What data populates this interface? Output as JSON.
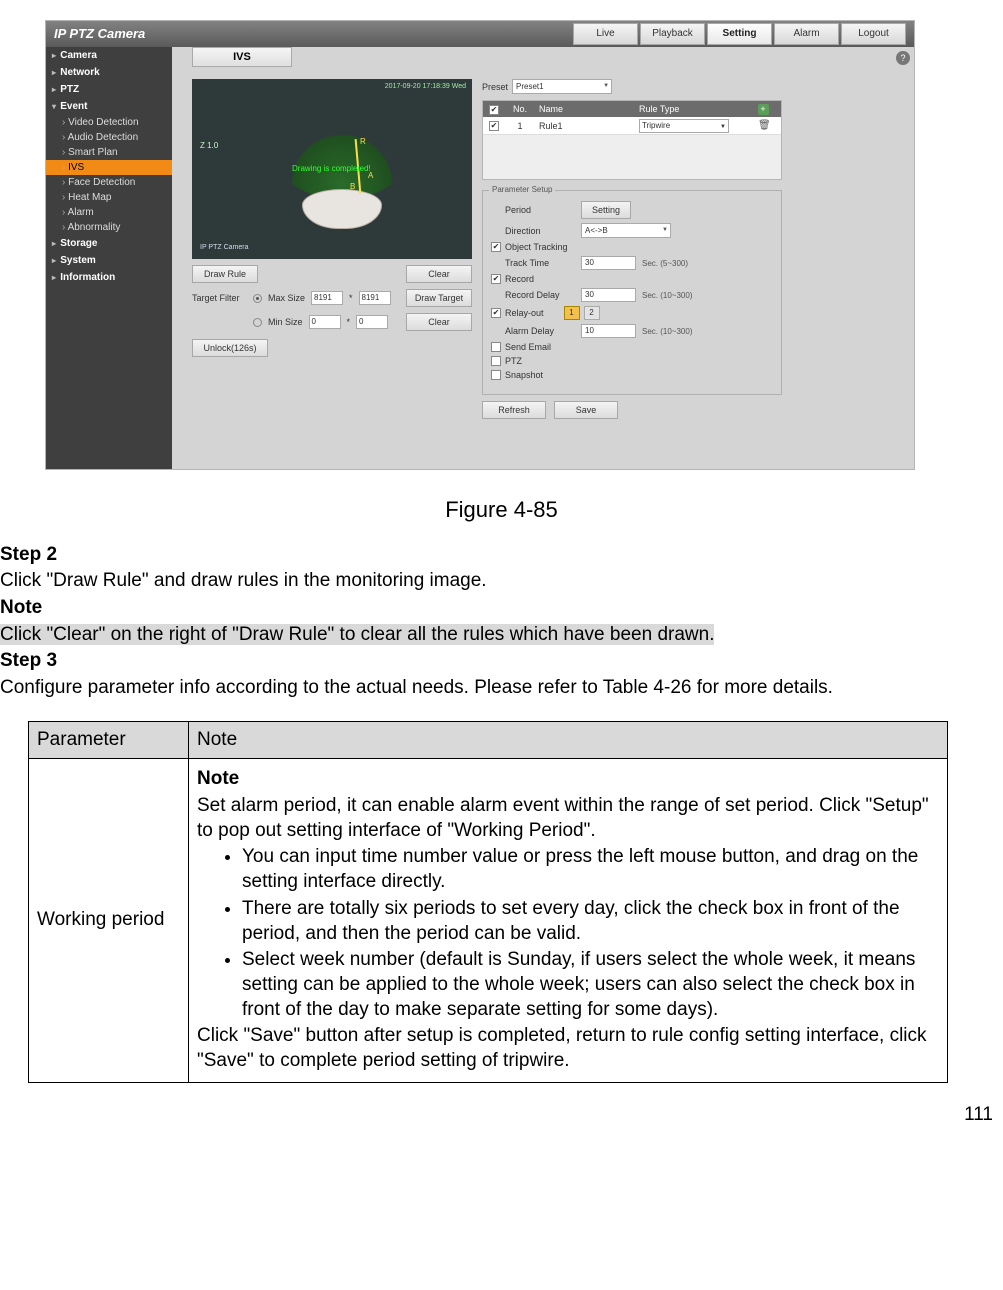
{
  "screenshot": {
    "brand": "IP PTZ Camera",
    "tabs": {
      "live": "Live",
      "playback": "Playback",
      "setting": "Setting",
      "alarm": "Alarm",
      "logout": "Logout"
    },
    "help_icon": "?",
    "ivs_tab": "IVS",
    "sidebar": {
      "camera": "Camera",
      "network": "Network",
      "ptz": "PTZ",
      "event": "Event",
      "event_items": {
        "video": "Video Detection",
        "audio": "Audio Detection",
        "smart": "Smart Plan",
        "ivs": "IVS",
        "face": "Face Detection",
        "heat": "Heat Map",
        "alarm": "Alarm",
        "abnorm": "Abnormality"
      },
      "storage": "Storage",
      "system": "System",
      "information": "Information"
    },
    "video": {
      "timestamp": "2017-09-20 17:18:39 Wed",
      "zoom": "Z 1.0",
      "watermark": "IP PTZ Camera",
      "center": "Drawing is completed!",
      "markR": "R",
      "markB": "B",
      "markA": "A"
    },
    "left": {
      "draw_rule": "Draw Rule",
      "clear": "Clear",
      "target_filter": "Target Filter",
      "max_size": "Max Size",
      "min_size": "Min Size",
      "max_w": "8191",
      "max_h": "8191",
      "min_w": "0",
      "min_h": "0",
      "draw_target": "Draw Target",
      "unlock": "Unlock(126s)",
      "times": "*"
    },
    "right": {
      "preset_label": "Preset",
      "preset_value": "Preset1",
      "table": {
        "hdr_no": "No.",
        "hdr_name": "Name",
        "hdr_type": "Rule Type",
        "add_icon": "+",
        "row_no": "1",
        "row_name": "Rule1",
        "row_type": "Tripwire",
        "del_icon": "🗑"
      },
      "params_legend": "Parameter Setup",
      "period": "Period",
      "period_btn": "Setting",
      "direction": "Direction",
      "direction_value": "A<->B",
      "obj_track": "Object Tracking",
      "track_time": "Track Time",
      "track_time_val": "30",
      "track_time_hint": "Sec. (5~300)",
      "record": "Record",
      "record_delay": "Record Delay",
      "record_delay_val": "30",
      "record_delay_hint": "Sec. (10~300)",
      "relay_out": "Relay-out",
      "relay1": "1",
      "relay2": "2",
      "alarm_delay": "Alarm Delay",
      "alarm_delay_val": "10",
      "alarm_delay_hint": "Sec. (10~300)",
      "send_email": "Send Email",
      "ptz": "PTZ",
      "snapshot": "Snapshot",
      "refresh": "Refresh",
      "save": "Save"
    }
  },
  "doc": {
    "figure": "Figure 4-85",
    "step2": "Step 2",
    "step2_line": "Click \"Draw Rule\" and draw rules in the monitoring image.",
    "note_title": "Note",
    "note_line": "Click \"Clear\" on the right of \"Draw Rule\" to clear all the rules which have been drawn.",
    "step3": "Step 3",
    "step3_line": "Configure parameter info according to the actual needs. Please refer to Table 4-26 for more details.",
    "table": {
      "hdr_param": "Parameter",
      "hdr_note": "Note",
      "row_param": "Working period",
      "row_note_title": "Note",
      "row_note_p1": "Set alarm period, it can enable alarm event within the range of set period. Click \"Setup\" to pop out setting interface of \"Working Period\".",
      "row_note_li1": "You can input time number value or press the left mouse button, and drag on the setting interface directly.",
      "row_note_li2": "There are totally six periods to set every day, click the check box in front of the period, and then the period can be valid.",
      "row_note_li3": "Select week number (default is Sunday, if users select the whole week, it means setting can be applied to the whole week; users can also select the check box in front of the day to make separate setting for some days).",
      "row_note_p2": "Click \"Save\" button after setup is completed, return to rule config setting interface, click \"Save\" to complete period setting of tripwire."
    },
    "page_num": "111"
  }
}
